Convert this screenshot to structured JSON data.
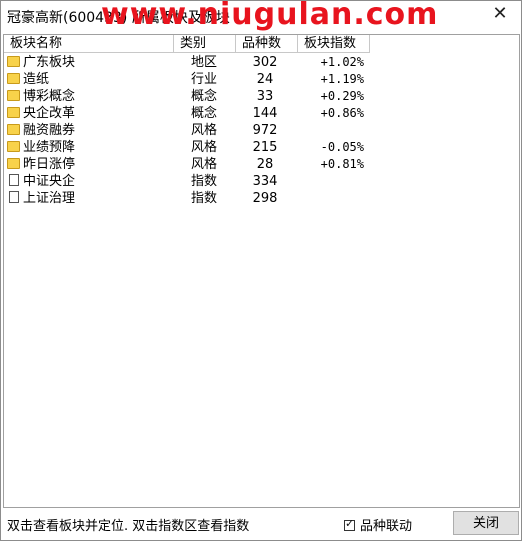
{
  "window": {
    "title": "冠豪高新(600433) 所属板块及板块",
    "watermark": "www.niugulan.com",
    "close_glyph": "✕"
  },
  "table": {
    "headers": [
      "板块名称",
      "类别",
      "品种数",
      "板块指数"
    ],
    "rows": [
      {
        "icon": "folder-icon",
        "name": "广东板块",
        "type": "地区",
        "count": "302",
        "index": "+1.02%"
      },
      {
        "icon": "folder-icon",
        "name": "造纸",
        "type": "行业",
        "count": "24",
        "index": "+1.19%"
      },
      {
        "icon": "folder-icon",
        "name": "博彩概念",
        "type": "概念",
        "count": "33",
        "index": "+0.29%"
      },
      {
        "icon": "folder-icon",
        "name": "央企改革",
        "type": "概念",
        "count": "144",
        "index": "+0.86%"
      },
      {
        "icon": "folder-icon",
        "name": "融资融券",
        "type": "风格",
        "count": "972",
        "index": ""
      },
      {
        "icon": "folder-icon",
        "name": "业绩预降",
        "type": "风格",
        "count": "215",
        "index": "-0.05%"
      },
      {
        "icon": "folder-icon",
        "name": "昨日涨停",
        "type": "风格",
        "count": "28",
        "index": "+0.81%"
      },
      {
        "icon": "document-icon",
        "name": "中证央企",
        "type": "指数",
        "count": "334",
        "index": ""
      },
      {
        "icon": "document-icon",
        "name": "上证治理",
        "type": "指数",
        "count": "298",
        "index": ""
      }
    ]
  },
  "footer": {
    "hint": "双击查看板块并定位. 双击指数区查看指数",
    "linkage_label": "品种联动",
    "linkage_checked": true,
    "close_label": "关闭"
  }
}
